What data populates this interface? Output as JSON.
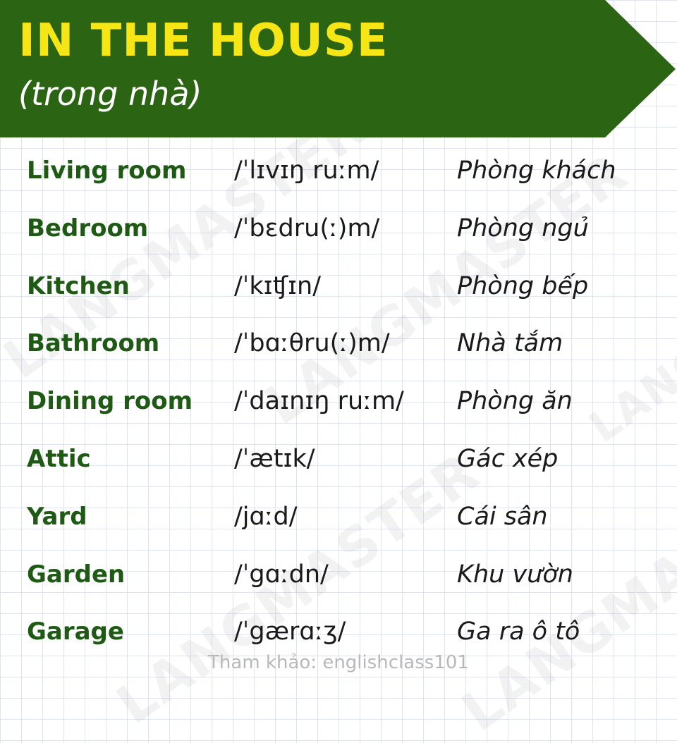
{
  "header": {
    "title": "IN THE HOUSE",
    "subtitle": "(trong nhà)"
  },
  "watermark": "LANGMASTER",
  "rows": [
    {
      "word": "Living room",
      "ipa": "/ˈlɪvɪŋ ruːm/",
      "meaning": "Phòng khách"
    },
    {
      "word": "Bedroom",
      "ipa": "/ˈbɛdru(ː)m/",
      "meaning": "Phòng ngủ"
    },
    {
      "word": "Kitchen",
      "ipa": "/ˈkɪʧɪn/",
      "meaning": "Phòng bếp"
    },
    {
      "word": "Bathroom",
      "ipa": "/ˈbɑːθru(ː)m/",
      "meaning": "Nhà tắm"
    },
    {
      "word": "Dining room",
      "ipa": "/ˈdaɪnɪŋ ruːm/",
      "meaning": "Phòng ăn"
    },
    {
      "word": "Attic",
      "ipa": "/ˈætɪk/",
      "meaning": "Gác xép"
    },
    {
      "word": "Yard",
      "ipa": "/jɑːd/",
      "meaning": "Cái sân"
    },
    {
      "word": "Garden",
      "ipa": "/ˈgɑːdn/",
      "meaning": "Khu vườn"
    },
    {
      "word": "Garage",
      "ipa": "/ˈgærɑːʒ/",
      "meaning": "Ga ra ô tô"
    }
  ],
  "footer": "Tham khảo: englishclass101",
  "colors": {
    "banner": "#2b6412",
    "title": "#f7e616",
    "word": "#1e5a14"
  }
}
